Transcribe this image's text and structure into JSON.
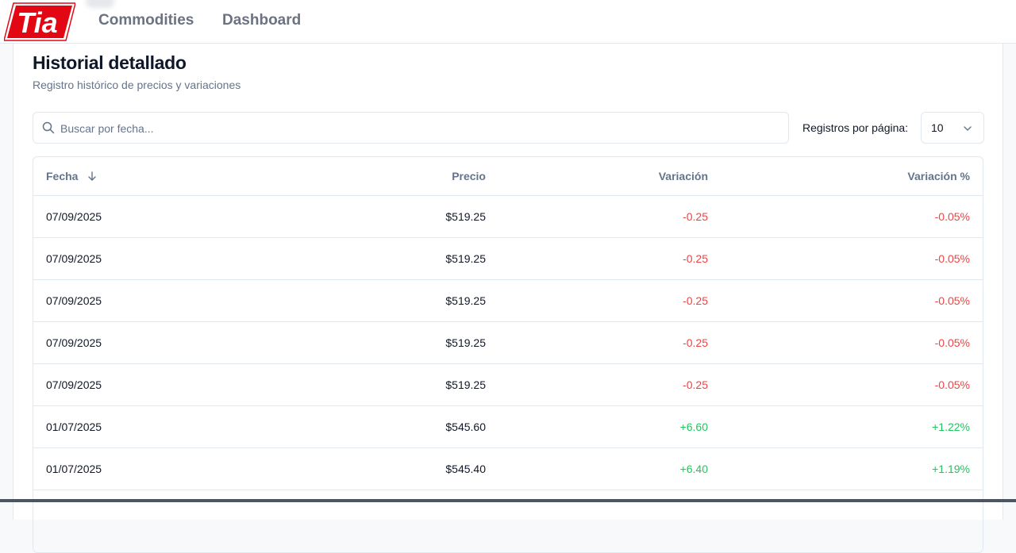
{
  "nav": {
    "logo_text": "Tia",
    "links": [
      "Commodities",
      "Dashboard"
    ]
  },
  "card": {
    "title": "Historial detallado",
    "subtitle": "Registro histórico de precios y variaciones"
  },
  "search": {
    "placeholder": "Buscar por fecha...",
    "value": ""
  },
  "pagination": {
    "label": "Registros por página:",
    "selected": "10"
  },
  "table": {
    "columns": [
      "Fecha",
      "Precio",
      "Variación",
      "Variación %"
    ],
    "sort": {
      "column": "Fecha",
      "direction": "desc"
    },
    "rows": [
      {
        "fecha": "07/09/2025",
        "precio": "$519.25",
        "variacion": "-0.25",
        "variacion_pct": "-0.05%",
        "trend": "neg"
      },
      {
        "fecha": "07/09/2025",
        "precio": "$519.25",
        "variacion": "-0.25",
        "variacion_pct": "-0.05%",
        "trend": "neg"
      },
      {
        "fecha": "07/09/2025",
        "precio": "$519.25",
        "variacion": "-0.25",
        "variacion_pct": "-0.05%",
        "trend": "neg"
      },
      {
        "fecha": "07/09/2025",
        "precio": "$519.25",
        "variacion": "-0.25",
        "variacion_pct": "-0.05%",
        "trend": "neg"
      },
      {
        "fecha": "07/09/2025",
        "precio": "$519.25",
        "variacion": "-0.25",
        "variacion_pct": "-0.05%",
        "trend": "neg"
      },
      {
        "fecha": "01/07/2025",
        "precio": "$545.60",
        "variacion": "+6.60",
        "variacion_pct": "+1.22%",
        "trend": "pos"
      },
      {
        "fecha": "01/07/2025",
        "precio": "$545.40",
        "variacion": "+6.40",
        "variacion_pct": "+1.19%",
        "trend": "pos"
      }
    ]
  },
  "colors": {
    "brand_red": "#e30613",
    "negative": "#ef4444",
    "positive": "#22c55e",
    "muted": "#64748b"
  },
  "icons": [
    "search-icon",
    "chevron-down-icon",
    "sort-arrow-down-icon"
  ]
}
